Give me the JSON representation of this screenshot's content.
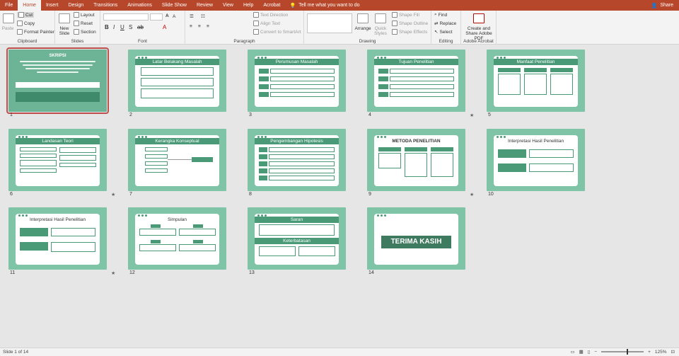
{
  "tabs": [
    "File",
    "Home",
    "Insert",
    "Design",
    "Transitions",
    "Animations",
    "Slide Show",
    "Review",
    "View",
    "Help",
    "Acrobat"
  ],
  "active_tab": "Home",
  "tell_me": "Tell me what you want to do",
  "share_label": "Share",
  "ribbon": {
    "clipboard": {
      "paste": "Paste",
      "cut": "Cut",
      "copy": "Copy",
      "format_painter": "Format Painter",
      "label": "Clipboard"
    },
    "slides": {
      "new_slide": "New Slide",
      "layout": "Layout",
      "reset": "Reset",
      "section": "Section",
      "label": "Slides"
    },
    "font": {
      "label": "Font"
    },
    "paragraph": {
      "text_direction": "Text Direction",
      "align_text": "Align Text",
      "convert": "Convert to SmartArt",
      "label": "Paragraph"
    },
    "drawing": {
      "arrange": "Arrange",
      "quick_styles": "Quick Styles",
      "shape_fill": "Shape Fill",
      "shape_outline": "Shape Outline",
      "shape_effects": "Shape Effects",
      "label": "Drawing"
    },
    "editing": {
      "find": "Find",
      "replace": "Replace",
      "select": "Select",
      "label": "Editing"
    },
    "acrobat": {
      "create_share": "Create and Share Adobe PDF",
      "label": "Adobe Acrobat"
    }
  },
  "slides": [
    {
      "n": "1",
      "title": "SKRIPSI"
    },
    {
      "n": "2",
      "title": "Latar Belakang Masalah"
    },
    {
      "n": "3",
      "title": "Perumusan Masalah"
    },
    {
      "n": "4",
      "title": "Tujuan Penelitian"
    },
    {
      "n": "5",
      "title": "Manfaat Penelitian"
    },
    {
      "n": "6",
      "title": "Landasan Teori"
    },
    {
      "n": "7",
      "title": "Kerangka Konseptual"
    },
    {
      "n": "8",
      "title": "Pengembangan Hipotesis"
    },
    {
      "n": "9",
      "title": "METODA PENELITIAN"
    },
    {
      "n": "10",
      "title": "Interpretasi Hasil Penelitian"
    },
    {
      "n": "11",
      "title": "Interpretasi Hasil Penelitian"
    },
    {
      "n": "12",
      "title": "Simpulan"
    },
    {
      "n": "13",
      "title": "Saran"
    },
    {
      "n": "14",
      "title": "TERIMA KASIH"
    }
  ],
  "slide13_sub": "Keterbatasan",
  "status": {
    "slide_of": "Slide 1 of 14",
    "zoom": "125%"
  }
}
